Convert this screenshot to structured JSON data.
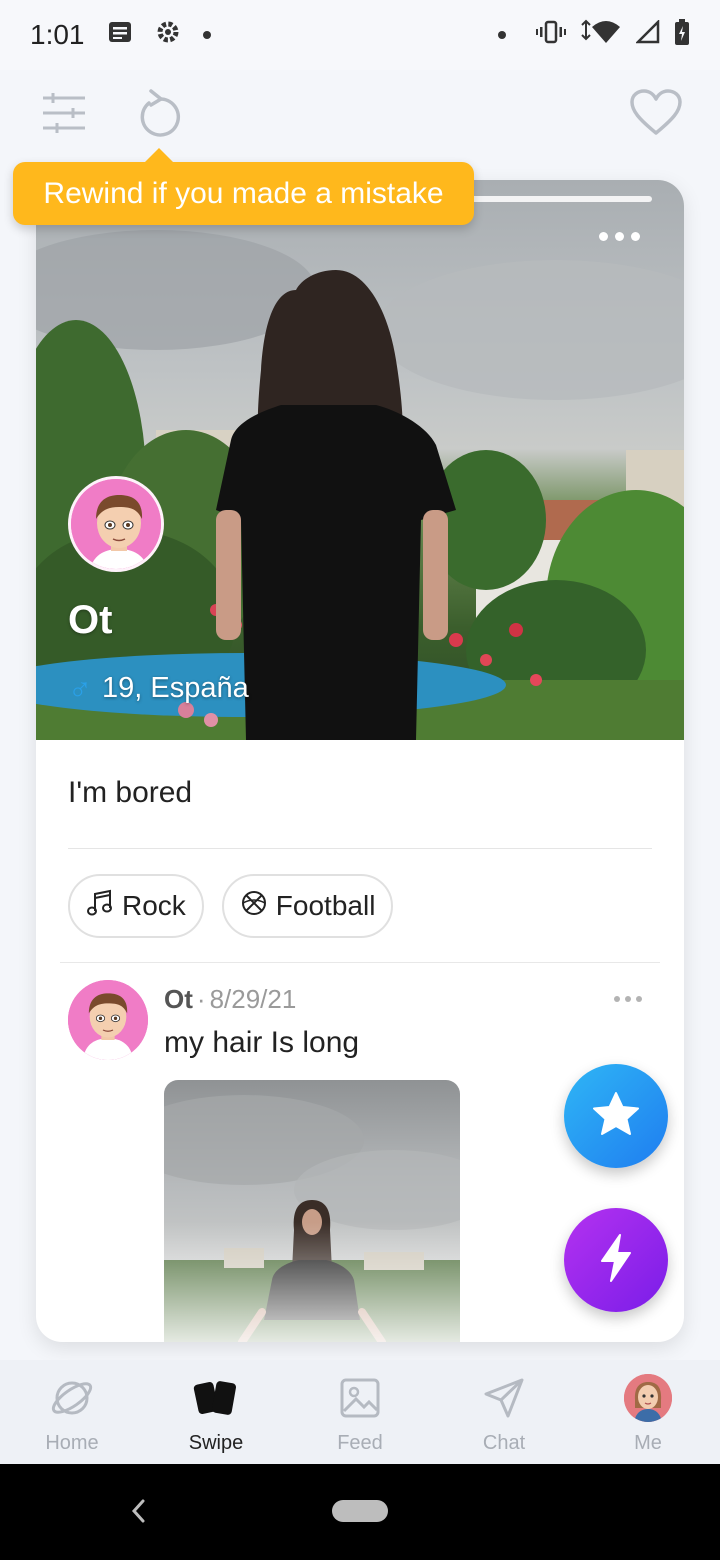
{
  "status_bar": {
    "time": "1:01"
  },
  "toolbar": {
    "filter_icon": "sliders-icon",
    "rewind_icon": "rewind-icon",
    "like_icon": "heart-outline-icon"
  },
  "tooltip": {
    "text": "Rewind if you made a mistake"
  },
  "profile": {
    "name": "Ot",
    "gender_symbol": "♂",
    "age_location": "19, España",
    "bio": "I'm bored",
    "tags": [
      {
        "label": "Rock",
        "icon": "music-note-icon"
      },
      {
        "label": "Football",
        "icon": "ball-icon"
      }
    ]
  },
  "post": {
    "author": "Ot",
    "separator": "·",
    "date": "8/29/21",
    "text": "my hair Is long"
  },
  "actions": {
    "star_icon": "star-icon",
    "boost_icon": "lightning-icon"
  },
  "nav": {
    "items": [
      {
        "label": "Home",
        "icon": "planet-icon",
        "active": false
      },
      {
        "label": "Swipe",
        "icon": "cards-icon",
        "active": true
      },
      {
        "label": "Feed",
        "icon": "image-icon",
        "active": false
      },
      {
        "label": "Chat",
        "icon": "send-icon",
        "active": false
      },
      {
        "label": "Me",
        "icon": "avatar",
        "active": false
      }
    ]
  },
  "colors": {
    "tooltip": "#ffb81c",
    "star_button": "#1f7df0",
    "boost_button": "#7a1de8",
    "gender": "#2aa0e8",
    "avatar_bg": "#f07cc6"
  }
}
